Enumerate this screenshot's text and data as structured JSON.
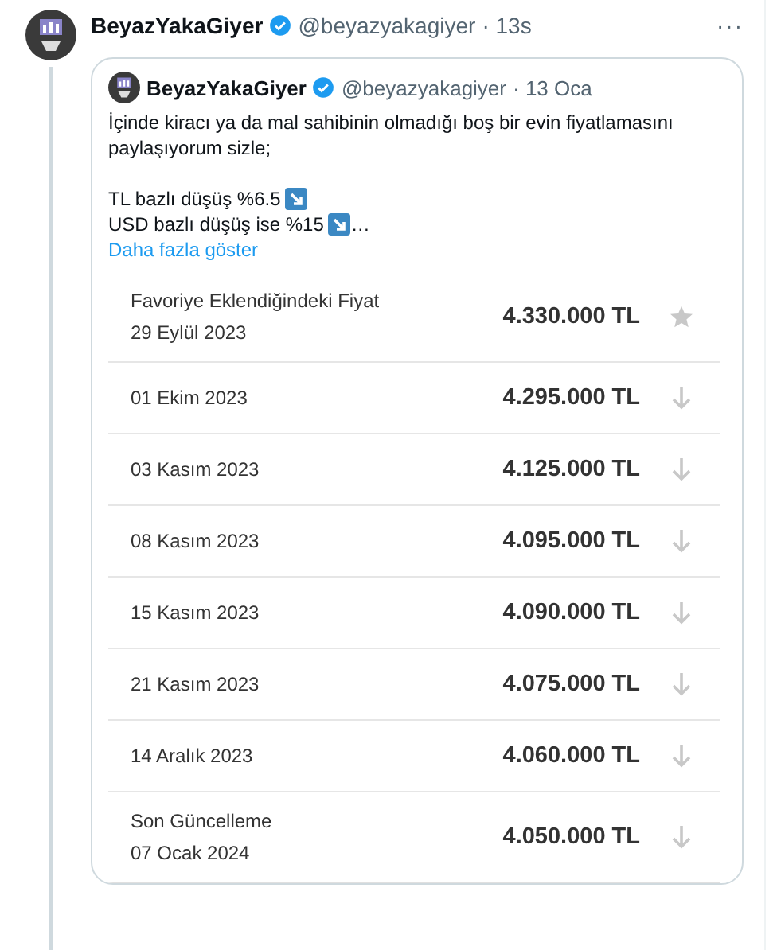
{
  "tweet": {
    "name": "BeyazYakaGiyer",
    "verified": true,
    "handle": "@beyazyakagiyer",
    "time": "· 13s",
    "more": "···"
  },
  "quote": {
    "name": "BeyazYakaGiyer",
    "verified": true,
    "handle": "@beyazyakagiyer",
    "time": "· 13 Oca",
    "paragraph": "İçinde kiracı ya da mal sahibinin olmadığı boş bir evin fiyatlamasını paylaşıyorum sizle;",
    "lines": [
      {
        "text": "TL bazlı düşüş %6.5",
        "arrow": true
      },
      {
        "text": "USD bazlı düşüş ise %15",
        "arrow": true,
        "suffix": "…"
      }
    ],
    "more_link": "Daha fazla göster",
    "price_rows": [
      {
        "kind": "favorite",
        "label": "Favoriye Eklendiğindeki Fiyat",
        "date": "29 Eylül 2023",
        "price": "4.330.000 TL"
      },
      {
        "kind": "drop",
        "date": "01 Ekim 2023",
        "price": "4.295.000 TL"
      },
      {
        "kind": "drop",
        "date": "03 Kasım 2023",
        "price": "4.125.000 TL"
      },
      {
        "kind": "drop",
        "date": "08 Kasım 2023",
        "price": "4.095.000 TL"
      },
      {
        "kind": "drop",
        "date": "15 Kasım 2023",
        "price": "4.090.000 TL"
      },
      {
        "kind": "drop",
        "date": "21 Kasım 2023",
        "price": "4.075.000 TL"
      },
      {
        "kind": "drop",
        "date": "14 Aralık 2023",
        "price": "4.060.000 TL"
      },
      {
        "kind": "drop",
        "label": "Son Güncelleme",
        "date": "07 Ocak 2024",
        "price": "4.050.000 TL"
      }
    ]
  }
}
